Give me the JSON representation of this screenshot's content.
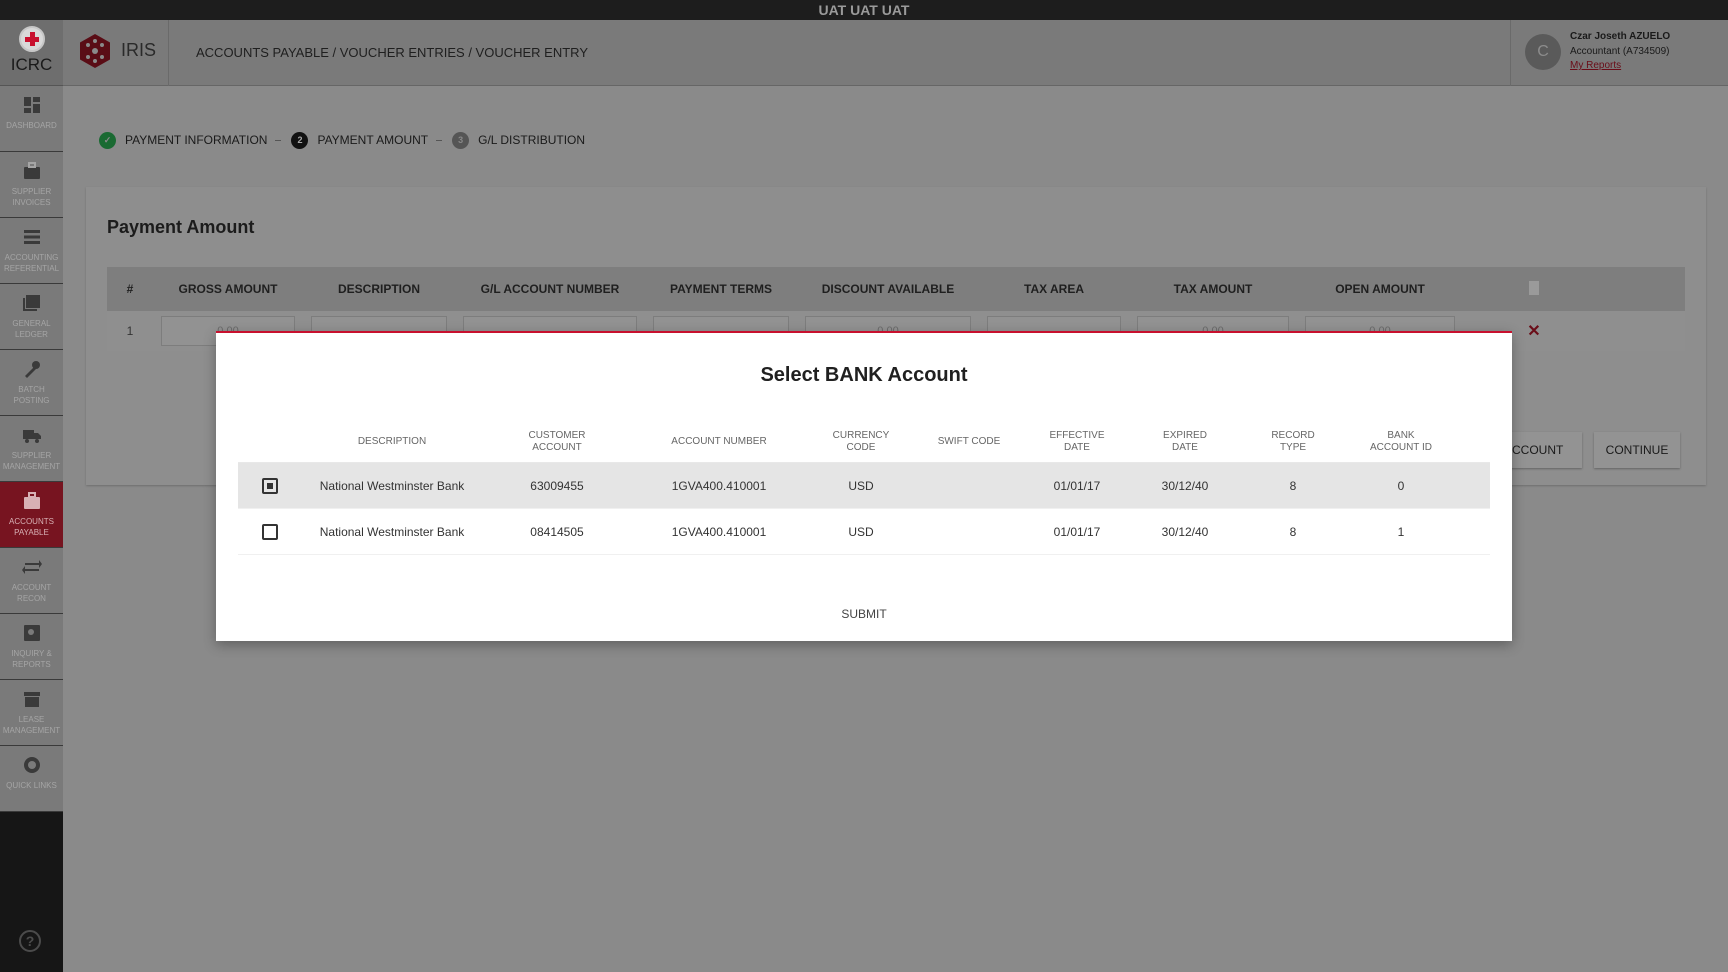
{
  "env_banner": "UAT UAT UAT",
  "logo": {
    "text": "ICRC"
  },
  "app": {
    "name": "IRIS"
  },
  "breadcrumb": "ACCOUNTS PAYABLE / VOUCHER ENTRIES / VOUCHER ENTRY",
  "user": {
    "initial": "C",
    "name": "Czar Joseth AZUELO",
    "role": "Accountant (A734509)",
    "link": "My Reports"
  },
  "sidebar": {
    "items": [
      {
        "l1": "DASHBOARD",
        "l2": "",
        "icon": "dashboard-icon",
        "active": false
      },
      {
        "l1": "SUPPLIER",
        "l2": "INVOICES",
        "icon": "briefcase-icon",
        "active": false
      },
      {
        "l1": "ACCOUNTING",
        "l2": "REFERENTIAL",
        "icon": "list-icon",
        "active": false
      },
      {
        "l1": "GENERAL",
        "l2": "LEDGER",
        "icon": "ledger-icon",
        "active": false
      },
      {
        "l1": "BATCH",
        "l2": "POSTING",
        "icon": "wrench-icon",
        "active": false
      },
      {
        "l1": "SUPPLIER",
        "l2": "MANAGEMENT",
        "icon": "truck-icon",
        "active": false
      },
      {
        "l1": "ACCOUNTS",
        "l2": "PAYABLE",
        "icon": "briefcase-icon",
        "active": true
      },
      {
        "l1": "ACCOUNT",
        "l2": "RECON",
        "icon": "arrows-icon",
        "active": false
      },
      {
        "l1": "INQUIRY &",
        "l2": "REPORTS",
        "icon": "search-report-icon",
        "active": false
      },
      {
        "l1": "LEASE",
        "l2": "MANAGEMENT",
        "icon": "store-icon",
        "active": false
      },
      {
        "l1": "QUICK LINKS",
        "l2": "",
        "icon": "globe-icon",
        "active": false
      }
    ],
    "help": "?"
  },
  "stepper": {
    "steps": [
      {
        "num": "✓",
        "label": "PAYMENT INFORMATION",
        "state": "done"
      },
      {
        "num": "2",
        "label": "PAYMENT AMOUNT",
        "state": "current"
      },
      {
        "num": "3",
        "label": "G/L DISTRIBUTION",
        "state": "next"
      }
    ]
  },
  "card": {
    "title": "Payment Amount",
    "columns": [
      "#",
      "GROSS AMOUNT",
      "DESCRIPTION",
      "G/L ACCOUNT NUMBER",
      "PAYMENT TERMS",
      "DISCOUNT AVAILABLE",
      "TAX AREA",
      "TAX AMOUNT",
      "OPEN AMOUNT"
    ],
    "row": {
      "num": "1",
      "gross": "0.00",
      "discount": "0.00",
      "tax": "0.00",
      "open": "0.00"
    },
    "buttons": {
      "account": "C ACCOUNT",
      "continue": "CONTINUE"
    }
  },
  "dialog": {
    "title": "Select BANK Account",
    "columns": {
      "description": "DESCRIPTION",
      "customer_1": "CUSTOMER",
      "customer_2": "ACCOUNT",
      "account_number": "ACCOUNT NUMBER",
      "currency_1": "CURRENCY",
      "currency_2": "CODE",
      "swift": "SWIFT CODE",
      "effective_1": "EFFECTIVE",
      "effective_2": "DATE",
      "expired_1": "EXPIRED",
      "expired_2": "DATE",
      "record_1": "RECORD",
      "record_2": "TYPE",
      "bankid_1": "BANK",
      "bankid_2": "ACCOUNT ID"
    },
    "rows": [
      {
        "selected": true,
        "description": "National Westminster Bank",
        "customer_account": "63009455",
        "account_number": "1GVA400.410001",
        "currency": "USD",
        "swift": "",
        "effective": "01/01/17",
        "expired": "30/12/40",
        "record_type": "8",
        "bank_account_id": "0"
      },
      {
        "selected": false,
        "description": "National Westminster Bank",
        "customer_account": "08414505",
        "account_number": "1GVA400.410001",
        "currency": "USD",
        "swift": "",
        "effective": "01/01/17",
        "expired": "30/12/40",
        "record_type": "8",
        "bank_account_id": "1"
      }
    ],
    "submit": "SUBMIT"
  }
}
